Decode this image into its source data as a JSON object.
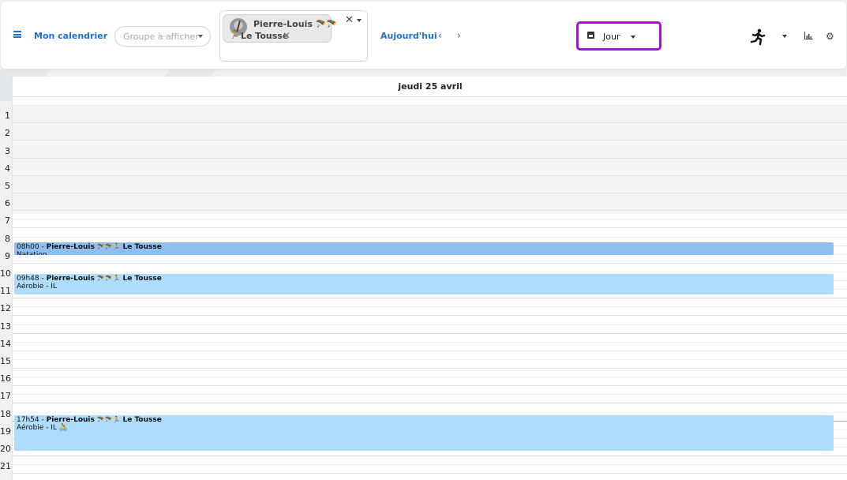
{
  "header": {
    "calendar_title": "Mon calendrier",
    "group_placeholder": "Groupe à afficher",
    "selected_athlete": {
      "name_line1": "Pierre-Louis 🪂🪂",
      "name_line2": "Le Tousse"
    },
    "today_label": "Aujourd'hui",
    "prev_label": "‹",
    "next_label": "›",
    "view_label": "Jour"
  },
  "calendar": {
    "day_label": "jeudi 25 avril",
    "hours": [
      "1",
      "2",
      "3",
      "4",
      "5",
      "6",
      "7",
      "8",
      "9",
      "10",
      "11",
      "12",
      "13",
      "14",
      "15",
      "16",
      "17",
      "18",
      "19",
      "20",
      "21"
    ],
    "events": [
      {
        "time": "08h00",
        "who": "Pierre-Louis",
        "icons": "🪂🪂🏃",
        "last": "Le Tousse",
        "subtitle": "Natation",
        "color": "#8fbfee"
      },
      {
        "time": "09h48",
        "who": "Pierre-Louis",
        "icons": "🪂🪂🏃",
        "last": "Le Tousse",
        "subtitle": "Aérobie - IL",
        "color": "#aedcfb"
      },
      {
        "time": "17h54",
        "who": "Pierre-Louis",
        "icons": "🪂🪂🏃",
        "last": "Le Tousse",
        "subtitle": "Aérobie - IL 🚴",
        "color": "#aedcfb"
      }
    ]
  },
  "colors": {
    "accent": "#1e6fd9",
    "view_highlight": "#a313d6"
  },
  "icons": [
    "hamburger-icon",
    "calendar-icon",
    "running-icon",
    "chart-icon",
    "gear-icon",
    "close-icon",
    "chevron-down-icon"
  ]
}
